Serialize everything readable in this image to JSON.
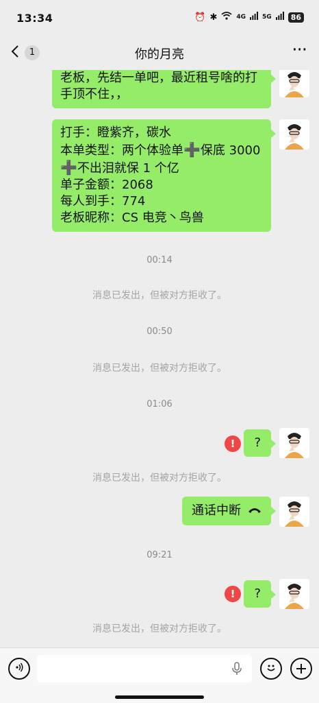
{
  "status": {
    "time": "13:34",
    "battery": "86",
    "net1": "4G",
    "net2": "5G"
  },
  "nav": {
    "back_count": "1",
    "title": "你的月亮",
    "more": "···"
  },
  "messages": {
    "m1": {
      "lines": [
        "老板，先结一单吧，最近租号啥的打",
        "手顶不住，，"
      ]
    },
    "m2": {
      "l1": "打手：瞪紫齐，碳水",
      "l2a": "本单类型：两个体验单",
      "plus": "➕",
      "l2b": "保底 3000",
      "l3b": "不出泪就保 1 个亿",
      "l4": "单子金额：2068",
      "l5": "每人到手：774",
      "l6": "老板昵称：CS 电竞丶鸟兽"
    },
    "m3": {
      "text": "?"
    },
    "m4": {
      "text": "通话中断"
    },
    "m5": {
      "text": "?"
    }
  },
  "timestamps": [
    "00:14",
    "00:50",
    "01:06",
    "09:21"
  ],
  "system_notice": "消息已发出，但被对方拒收了。",
  "error_badge": "!",
  "input": {
    "placeholder": ""
  }
}
